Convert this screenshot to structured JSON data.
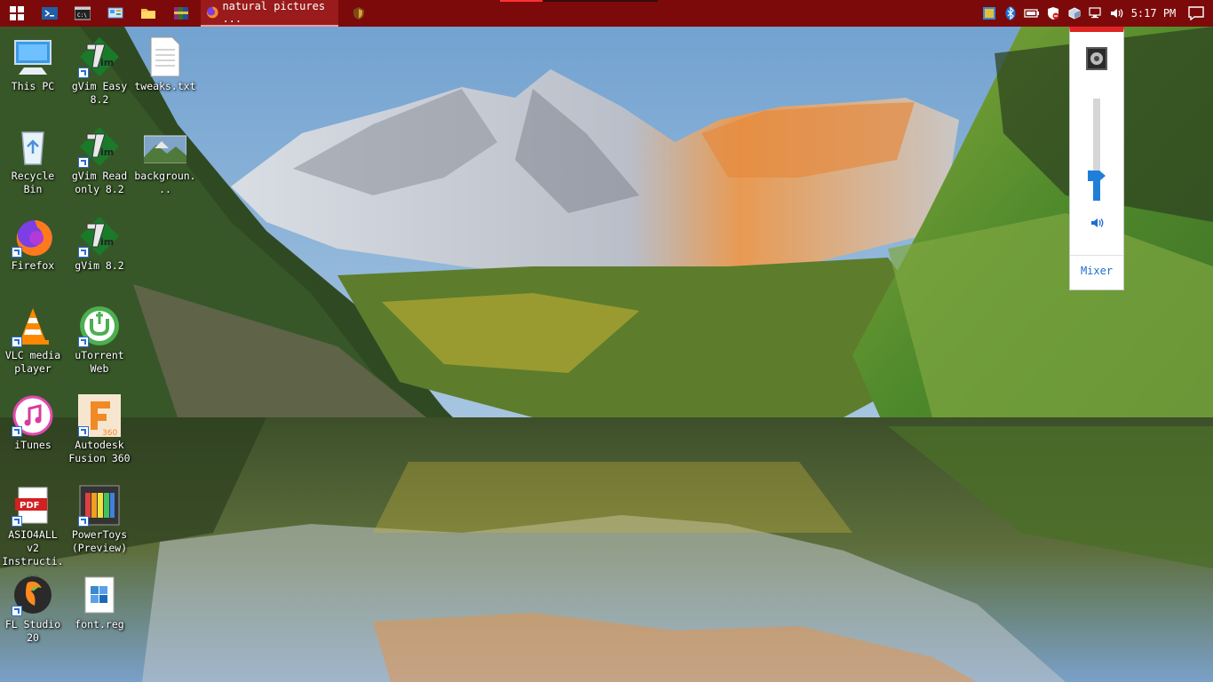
{
  "taskbar": {
    "active_window_title": "natural pictures ...",
    "clock": "5:17 PM"
  },
  "desktop_icons": [
    {
      "label": "This PC",
      "icon": "computer-icon"
    },
    {
      "label": "gVim Easy 8.2",
      "icon": "vim-icon"
    },
    {
      "label": "tweaks.txt",
      "icon": "text-file-icon"
    },
    {
      "label": "Recycle Bin",
      "icon": "recycle-bin-icon"
    },
    {
      "label": "gVim Read only 8.2",
      "icon": "vim-icon"
    },
    {
      "label": "backgroun...",
      "icon": "image-file-icon"
    },
    {
      "label": "Firefox",
      "icon": "firefox-icon"
    },
    {
      "label": "gVim 8.2",
      "icon": "vim-icon"
    },
    {
      "label": "VLC media player",
      "icon": "vlc-icon"
    },
    {
      "label": "uTorrent Web",
      "icon": "utorrent-icon"
    },
    {
      "label": "iTunes",
      "icon": "itunes-icon"
    },
    {
      "label": "Autodesk Fusion 360",
      "icon": "fusion360-icon"
    },
    {
      "label": "ASIO4ALL v2 Instructi...",
      "icon": "pdf-icon"
    },
    {
      "label": "PowerToys (Preview)",
      "icon": "powertoys-icon"
    },
    {
      "label": "FL Studio 20",
      "icon": "fl-studio-icon"
    },
    {
      "label": "font.reg",
      "icon": "registry-file-icon"
    }
  ],
  "volume_flyout": {
    "level_fraction": 0.27,
    "mixer_label": "Mixer"
  },
  "colors": {
    "taskbar": "#7c0a0a",
    "accent": "#1f7fd8"
  }
}
